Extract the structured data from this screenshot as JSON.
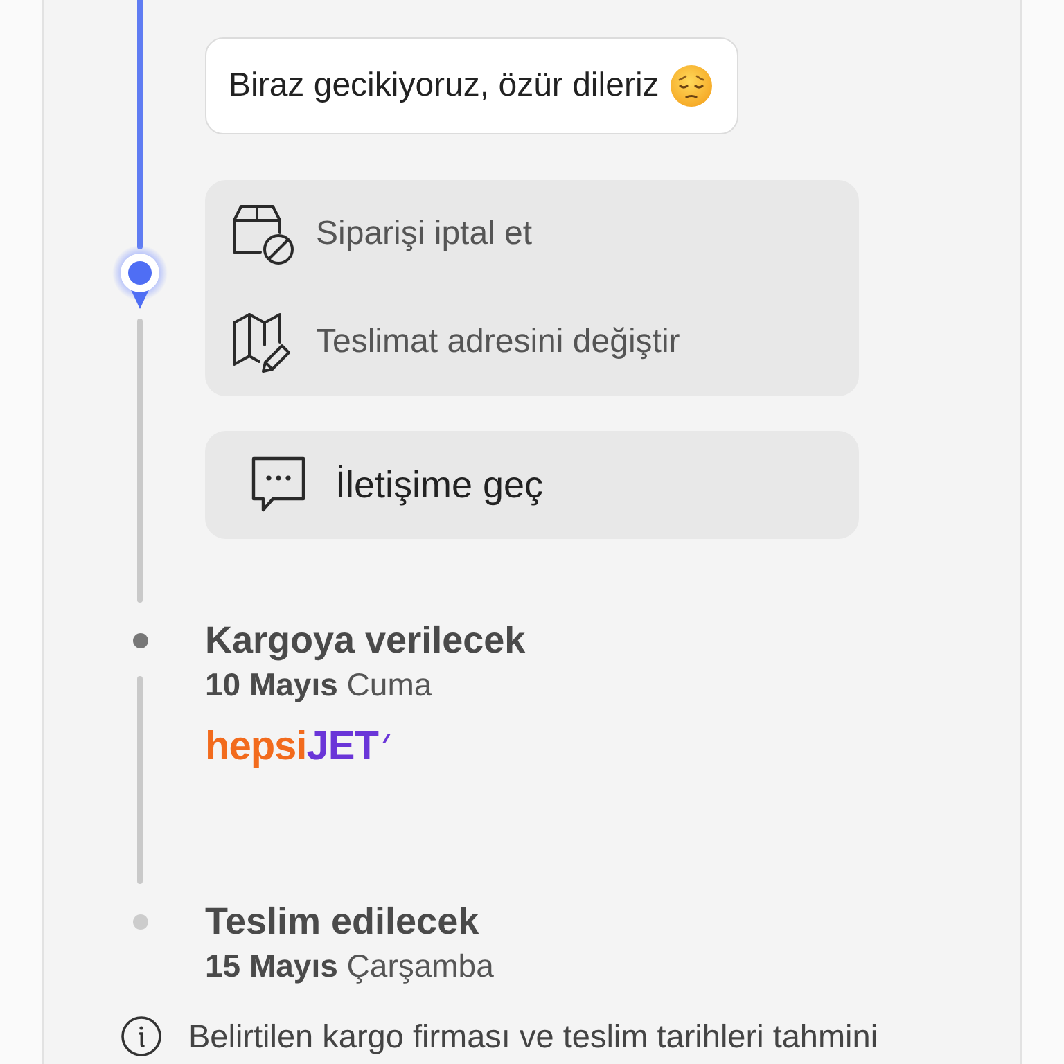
{
  "timeline": {
    "steps": [
      {
        "kind": "current",
        "message": "Biraz gecikiyoruz, özür dileriz",
        "actions": [
          {
            "kind": "cancel",
            "label": "Siparişi iptal et"
          },
          {
            "kind": "address",
            "label": "Teslimat adresini değiştir"
          }
        ],
        "contact": {
          "label": "İletişime geç"
        }
      },
      {
        "kind": "upcoming",
        "color": "#777777",
        "title": "Kargoya verilecek",
        "date": "**10 Mayıs** Cuma",
        "carrier": {
          "logo_parts": [
            "hepsi",
            "JET"
          ]
        }
      },
      {
        "kind": "upcoming",
        "color": "#cccccc",
        "title": "Teslim edilecek",
        "date": "**15 Mayıs** Çarşamba"
      }
    ]
  },
  "notice": {
    "text": "Belirtilen kargo firması ve teslim tarihleri tahmini"
  }
}
